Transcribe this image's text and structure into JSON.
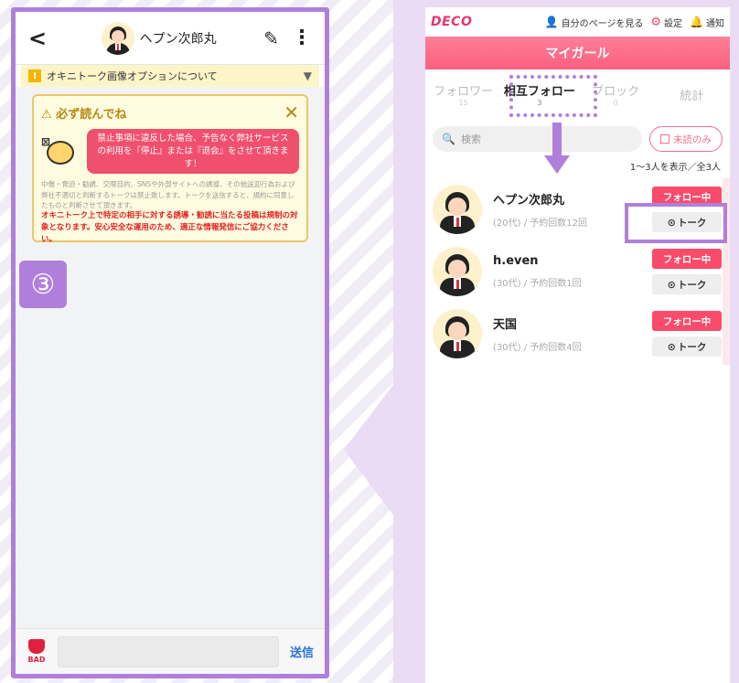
{
  "chat": {
    "partner_name": "ヘプン次郎丸",
    "notice": "オキニトーク画像オプションについて",
    "rules": {
      "title": "必ず読んでね",
      "bubble": "禁止事項に違反した場合、予告なく弊社サービスの利用を『停止』または『退会』をさせて頂きます！",
      "small": "中傷・脅迫・勧誘、交際目的、SNSや外部サイトへの誘導、その他送迎行為および弊社不適切と判断するトークは禁止致します。トークを送信すると、規約に同意したものと判断させて頂きます。",
      "red": "オキニトーク上で特定の相手に対する誘導・勧誘に当たる投稿は規制の対象となります。安心安全な運用のため、適正な情報発信にご協力ください。"
    },
    "step": "③",
    "bad_label": "BAD",
    "send_label": "送信"
  },
  "app": {
    "logo": "DECO",
    "my_page": "自分のページを見る",
    "settings": "設定",
    "notifications": "通知",
    "header": "マイガール",
    "tabs": [
      {
        "label": "フォロワー",
        "count": "15"
      },
      {
        "label": "相互フォロー",
        "count": "3"
      },
      {
        "label": "ブロック",
        "count": "0"
      },
      {
        "label": "統計",
        "count": ""
      }
    ],
    "search_placeholder": "検索",
    "unread_only": "未読のみ",
    "count_text": "1〜3人を表示／全3人",
    "follow_label": "フォロー中",
    "talk_label": "トーク",
    "users": [
      {
        "name": "ヘプン次郎丸",
        "meta": "(20代) / 予約回数12回"
      },
      {
        "name": "h.even",
        "meta": "(30代) / 予約回数1回"
      },
      {
        "name": "天国",
        "meta": "(30代) / 予約回数4回"
      }
    ]
  },
  "colors": {
    "accent_purple": "#b07fdc",
    "brand_pink": "#fa4b6a",
    "send_blue": "#2a73d9"
  }
}
